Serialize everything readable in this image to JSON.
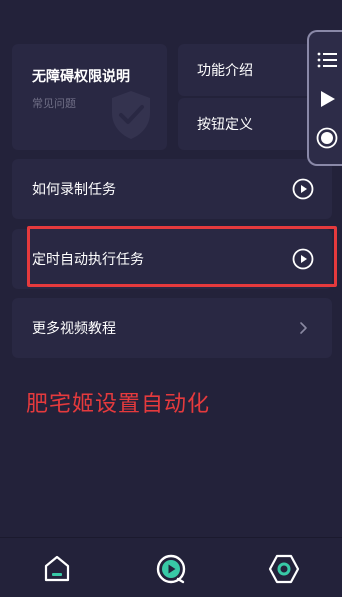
{
  "accessibility_card": {
    "title": "无障碍权限说明",
    "subtitle": "常见问题",
    "icon": "shield-check-icon"
  },
  "quick_cards": [
    {
      "label": "功能介绍"
    },
    {
      "label": "按钮定义"
    }
  ],
  "tutorial_rows": [
    {
      "label": "如何录制任务",
      "trailing_icon": "play-circle-icon"
    },
    {
      "label": "定时自动执行任务",
      "trailing_icon": "play-circle-icon",
      "highlighted": true
    },
    {
      "label": "更多视频教程",
      "trailing_icon": "chevron-right-icon"
    }
  ],
  "annotation": "肥宅姬设置自动化",
  "floating_toolbar": [
    "list-icon",
    "play-icon",
    "record-icon"
  ],
  "bottom_nav": [
    "home-icon",
    "video-play-icon",
    "settings-hex-icon"
  ],
  "colors": {
    "background": "#23223a",
    "card": "#292843",
    "highlight": "#e53a3d",
    "accent": "#38c9a6",
    "toolbar_border": "#8a89a8"
  }
}
